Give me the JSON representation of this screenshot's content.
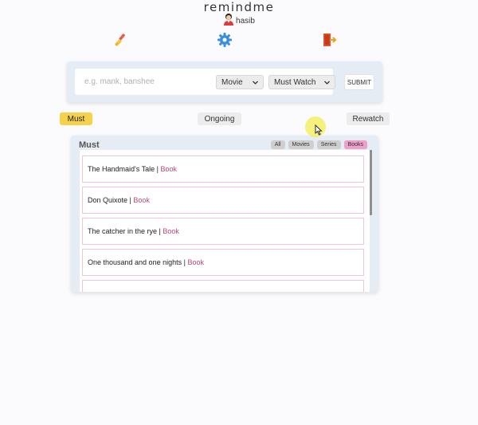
{
  "app": {
    "title": "remindme",
    "user": "hasib"
  },
  "toolbar": {
    "icons": [
      "broom-icon",
      "gear-icon",
      "logout-icon"
    ]
  },
  "form": {
    "search_placeholder": "e.g. mank, banshee",
    "type_select": "Movie",
    "category_select": "Must Watch",
    "submit_label": "SUBMIT"
  },
  "tabs": [
    "Must",
    "Ongoing",
    "Rewatch"
  ],
  "list": {
    "title": "Must",
    "filters": [
      "All",
      "Movies",
      "Series",
      "Books"
    ],
    "active_filter": "Books",
    "items": [
      {
        "name": "The Handmaid's Tale",
        "sep": " | ",
        "type": "Book"
      },
      {
        "name": "Don Quixote",
        "sep": " | ",
        "type": "Book"
      },
      {
        "name": "The catcher in the rye",
        "sep": " | ",
        "type": "Book"
      },
      {
        "name": "One thousand and one nights",
        "sep": " | ",
        "type": "Book"
      }
    ]
  },
  "colors": {
    "accent": "#f6d24b",
    "book_type": "#c0457a",
    "active_filter": "#ee9fca",
    "card_bg": "#e5ecf3"
  }
}
